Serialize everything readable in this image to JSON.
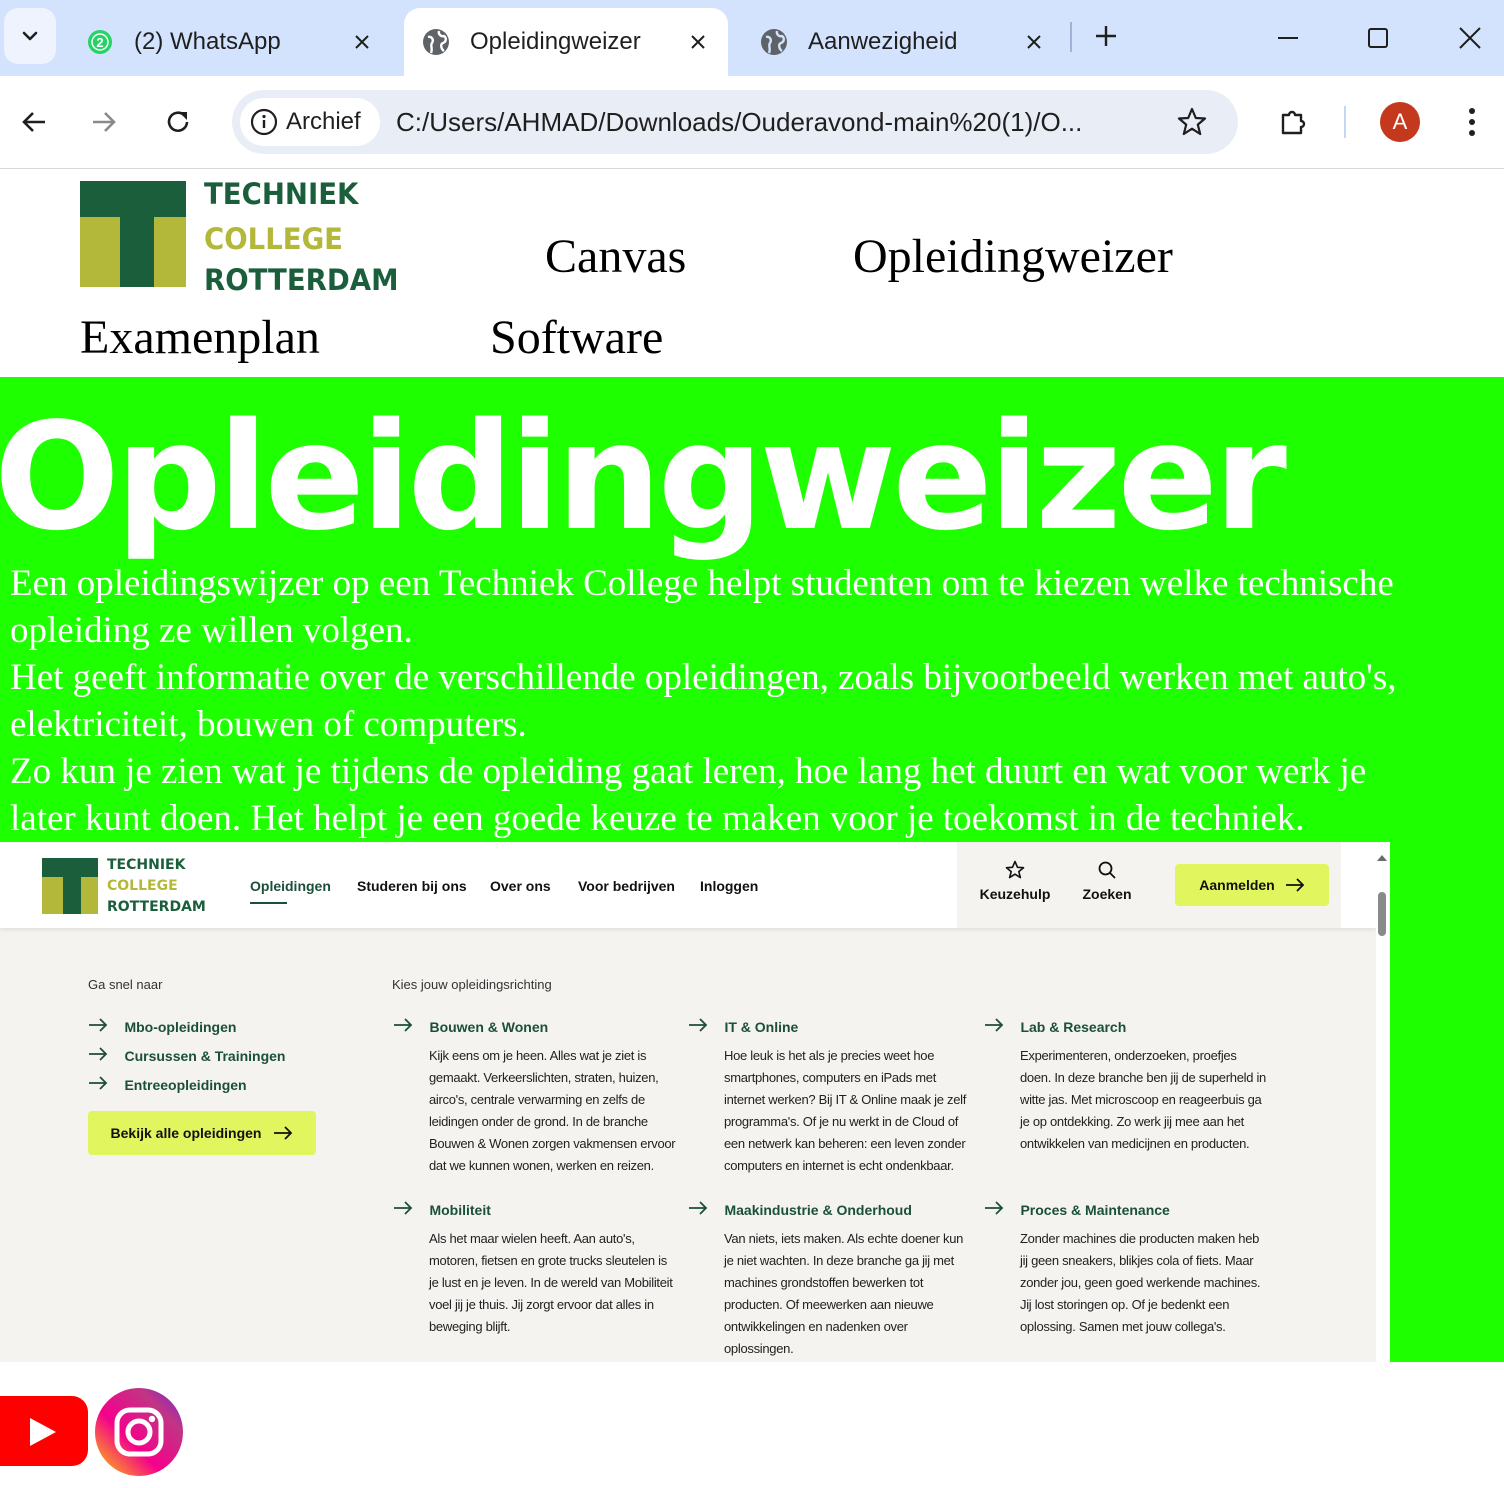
{
  "browser": {
    "tabs": [
      {
        "title": "(2) WhatsApp",
        "badge": "2"
      },
      {
        "title": "Opleidingweizer"
      },
      {
        "title": "Aanwezigheid"
      }
    ],
    "address": {
      "chip_label": "Archief",
      "url": "C:/Users/AHMAD/Downloads/Ouderavond-main%20(1)/O..."
    },
    "profile_initial": "A"
  },
  "site": {
    "logo": {
      "line1": "TECHNIEK",
      "line2": "COLLEGE",
      "line3": "ROTTERDAM"
    },
    "nav": [
      "Canvas",
      "Opleidingweizer",
      "Examenplan",
      "Software"
    ],
    "hero_title": "Opleidingweizer",
    "hero_paragraphs": [
      "Een opleidingswijzer op een Techniek College helpt studenten om te kiezen welke technische",
      "opleiding ze willen volgen.",
      "Het geeft informatie over de verschillende opleidingen, zoals bijvoorbeeld werken met auto's,",
      "elektriciteit, bouwen of computers.",
      "Zo kun je zien wat je tijdens de opleiding gaat leren, hoe lang het duurt en wat voor werk je",
      "later kunt doen. Het helpt je een goede keuze te maken voor je toekomst in de techniek."
    ],
    "colors": {
      "hero_bg": "#1eff00",
      "brand_green": "#1b5e3b",
      "brand_olive": "#b3b83a",
      "cta_yellow": "#e1f55e"
    },
    "social_icons": [
      "youtube-icon",
      "instagram-icon"
    ]
  },
  "embedded": {
    "logo": {
      "line1": "TECHNIEK",
      "line2": "COLLEGE",
      "line3": "ROTTERDAM"
    },
    "menu": [
      "Opleidingen",
      "Studeren bij ons",
      "Over ons",
      "Voor bedrijven",
      "Inloggen"
    ],
    "keuzehulp": "Keuzehulp",
    "zoeken": "Zoeken",
    "aanmelden": "Aanmelden",
    "quick_title": "Ga snel naar",
    "quick_links": [
      "Mbo-opleidingen",
      "Cursussen & Trainingen",
      "Entreeopleidingen"
    ],
    "bekijk": "Bekijk alle opleidingen",
    "kies_title": "Kies jouw opleidingsrichting",
    "directions": [
      {
        "title": "Bouwen & Wonen",
        "lines": [
          "Kijk eens om je heen. Alles wat je ziet is",
          "gemaakt. Verkeerslichten, straten, huizen,",
          "airco's, centrale verwarming en zelfs de",
          "leidingen onder de grond. In de branche",
          "Bouwen & Wonen zorgen vakmensen ervoor",
          "dat we kunnen wonen, werken en reizen."
        ]
      },
      {
        "title": "IT & Online",
        "lines": [
          "Hoe leuk is het als je precies weet hoe",
          "smartphones, computers en iPads met",
          "internet werken? Bij IT & Online maak je zelf",
          "programma's. Of je nu werkt in de Cloud of",
          "een netwerk kan beheren: een leven zonder",
          "computers en internet is echt ondenkbaar."
        ]
      },
      {
        "title": "Lab & Research",
        "lines": [
          "Experimenteren, onderzoeken, proefjes",
          "doen. In deze branche ben jij de superheld in",
          "witte jas. Met microscoop en reageerbuis ga",
          "je op ontdekking. Zo werk jij mee aan het",
          "ontwikkelen van medicijnen en producten."
        ]
      },
      {
        "title": "Mobiliteit",
        "lines": [
          "Als het maar wielen heeft. Aan auto's,",
          "motoren, fietsen en grote trucks sleutelen is",
          "je lust en je leven. In de wereld van Mobiliteit",
          "voel jij je thuis. Jij zorgt ervoor dat alles in",
          "beweging blijft."
        ]
      },
      {
        "title": "Maakindustrie & Onderhoud",
        "lines": [
          "Van niets, iets maken. Als echte doener kun",
          "je niet wachten. In deze branche ga jij met",
          "machines grondstoffen bewerken tot",
          "producten. Of meewerken aan nieuwe",
          "ontwikkelingen en nadenken over",
          "oplossingen."
        ]
      },
      {
        "title": "Proces & Maintenance",
        "lines": [
          "Zonder machines die producten maken heb",
          "jij geen sneakers, blikjes cola of fiets. Maar",
          "zonder jou, geen goed werkende machines.",
          "Jij lost storingen op. Of je bedenkt een",
          "oplossing. Samen met jouw collega's."
        ]
      }
    ]
  }
}
